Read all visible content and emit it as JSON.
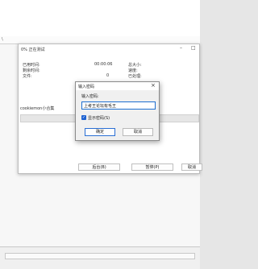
{
  "explorer": {
    "address_text": "\\"
  },
  "progress": {
    "title": "0% 正在测试",
    "minimize_icon": "minimize-icon",
    "maximize_icon": "maximize-icon",
    "elapsed_label": "已用时间:",
    "elapsed_value": "00:00:06",
    "remaining_label": "剩余时间:",
    "files_label": "文件:",
    "files_value": "0",
    "total_size_label": "总大小:",
    "speed_label": "速度:",
    "processed_label": "已处理:",
    "archive_name": "cookiemon小合集",
    "background_button": "后台(B)",
    "pause_button": "暂停(P)",
    "cancel_button": "取消"
  },
  "dialog": {
    "title": "输入密码",
    "close_icon": "close-icon",
    "prompt_label": "输入密码:",
    "password_value": "上考王论坛有毛王",
    "show_password_label": "显示密码(S)",
    "show_password_checked": true,
    "ok_button": "确定",
    "cancel_button": "取消"
  }
}
